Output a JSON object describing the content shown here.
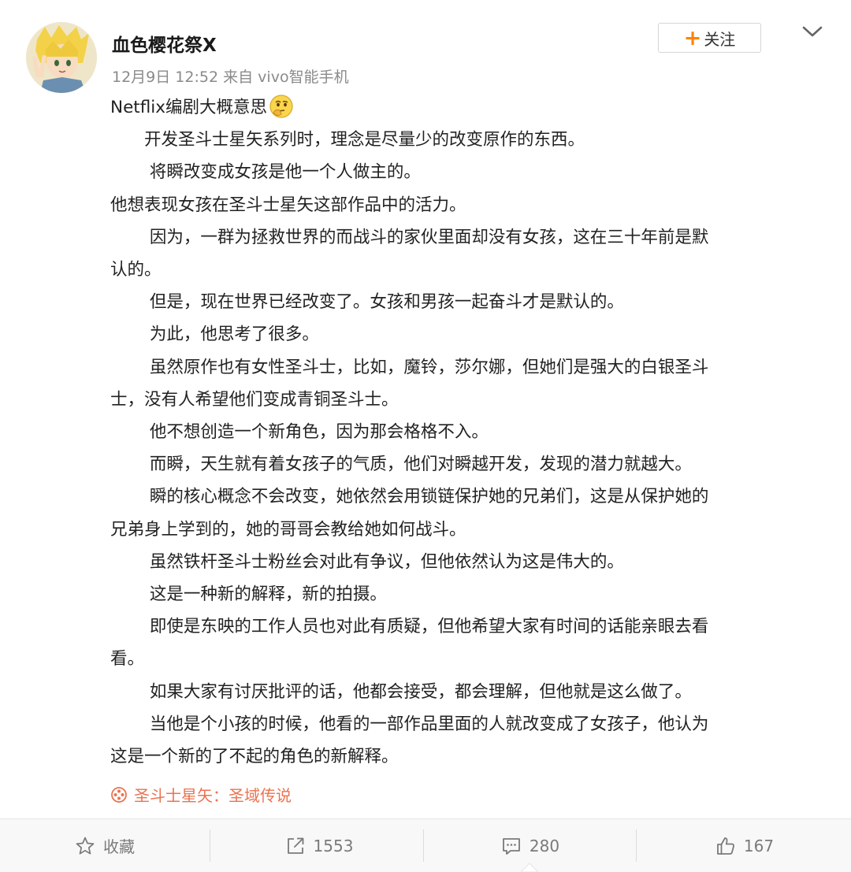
{
  "post": {
    "author": "血色樱花祭X",
    "time": "12月9日 12:52",
    "source_prefix": "来自",
    "source_device": "vivo智能手机",
    "follow_label": "关注",
    "lines": [
      "Netflix编剧大概意思",
      "　　开发圣斗士星矢系列时，理念是尽量少的改变原作的东西。",
      "　　 将瞬改变成女孩是他一个人做主的。",
      "他想表现女孩在圣斗士星矢这部作品中的活力。",
      "　　 因为，一群为拯救世界的而战斗的家伙里面却没有女孩，这在三十年前是默",
      "认的。",
      "　　 但是，现在世界已经改变了。女孩和男孩一起奋斗才是默认的。",
      "　　 为此，他思考了很多。",
      "　　 虽然原作也有女性圣斗士，比如，魔铃，莎尔娜，但她们是强大的白银圣斗",
      "士，没有人希望他们变成青铜圣斗士。",
      "　　 他不想创造一个新角色，因为那会格格不入。",
      "　　 而瞬，天生就有着女孩子的气质，他们对瞬越开发，发现的潜力就越大。",
      "　　 瞬的核心概念不会改变，她依然会用锁链保护她的兄弟们，这是从保护她的",
      "兄弟身上学到的，她的哥哥会教给她如何战斗。",
      "　　 虽然铁杆圣斗士粉丝会对此有争议，但他依然认为这是伟大的。",
      "　　 这是一种新的解释，新的拍摄。",
      "　　 即使是东映的工作人员也对此有质疑，但他希望大家有时间的话能亲眼去看",
      "看。",
      "　　 如果大家有讨厌批评的话，他都会接受，都会理解，但他就是这么做了。",
      "　　 当他是个小孩的时候，他看的一部作品里面的人就改变成了女孩子，他认为",
      "这是一个新的了不起的角色的新解释。"
    ],
    "topic": "圣斗士星矢：圣域传说"
  },
  "toolbar": {
    "favorite_label": "收藏",
    "repost_count": "1553",
    "comment_count": "280",
    "like_count": "167"
  },
  "icons": {
    "follow": "plus-icon",
    "menu": "chevron-down-icon",
    "emoji": "thinking-face-emoji-icon",
    "topic": "film-reel-icon",
    "favorite": "star-icon",
    "repost": "share-icon",
    "comment": "comment-bubble-icon",
    "like": "thumbs-up-icon"
  },
  "colors": {
    "accent": "#ff8200",
    "topic": "#eb7350",
    "meta": "#8a8a8a",
    "toolbar_bg": "#f8f8f8"
  }
}
